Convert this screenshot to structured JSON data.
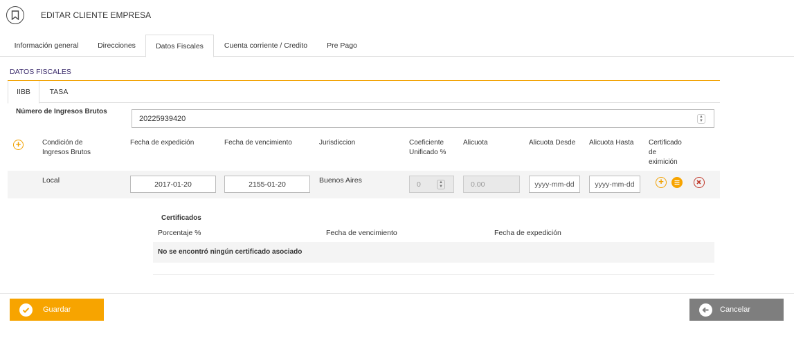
{
  "header": {
    "title": "EDITAR CLIENTE EMPRESA",
    "icon": "bookmark-icon"
  },
  "tabs": [
    {
      "label": "Información general"
    },
    {
      "label": "Direcciones"
    },
    {
      "label": "Datos Fiscales",
      "active": true
    },
    {
      "label": "Cuenta corriente / Credito"
    },
    {
      "label": "Pre Pago"
    }
  ],
  "section": {
    "title": "DATOS FISCALES"
  },
  "subtabs": [
    {
      "label": "IIBB",
      "active": true
    },
    {
      "label": "TASA"
    }
  ],
  "iibb": {
    "label": "Número de Ingresos Brutos",
    "value": "20225939420"
  },
  "table": {
    "headers": {
      "condicion": [
        "Condición de",
        "Ingresos Brutos"
      ],
      "fecha_expedicion": "Fecha de expedición",
      "fecha_vencimiento": "Fecha de vencimiento",
      "jurisdiccion": "Jurisdiccion",
      "coeficiente": [
        "Coeficiente",
        "Unificado %"
      ],
      "alicuota": "Alicuota",
      "alicuota_desde": "Alicuota Desde",
      "alicuota_hasta": "Alicuota Hasta",
      "certificado": [
        "Certificado",
        "de",
        "eximición"
      ]
    },
    "row": {
      "condicion": "Local",
      "fecha_expedicion": "2017-01-20",
      "fecha_vencimiento": "2155-01-20",
      "jurisdiccion": "Buenos Aires",
      "coeficiente": "0",
      "alicuota": "0.00",
      "alicuota_desde_placeholder": "yyyy-mm-dd",
      "alicuota_hasta_placeholder": "yyyy-mm-dd"
    }
  },
  "certificados": {
    "title": "Certificados",
    "columns": [
      "Porcentaje %",
      "Fecha de vencimiento",
      "Fecha de expedición"
    ],
    "empty": "No se encontró ningún certificado asociado"
  },
  "footer": {
    "save_label": "Guardar",
    "cancel_label": "Cancelar"
  },
  "colors": {
    "accent": "#f7a400",
    "danger": "#c0392b",
    "cancel": "#7e7e7e"
  }
}
